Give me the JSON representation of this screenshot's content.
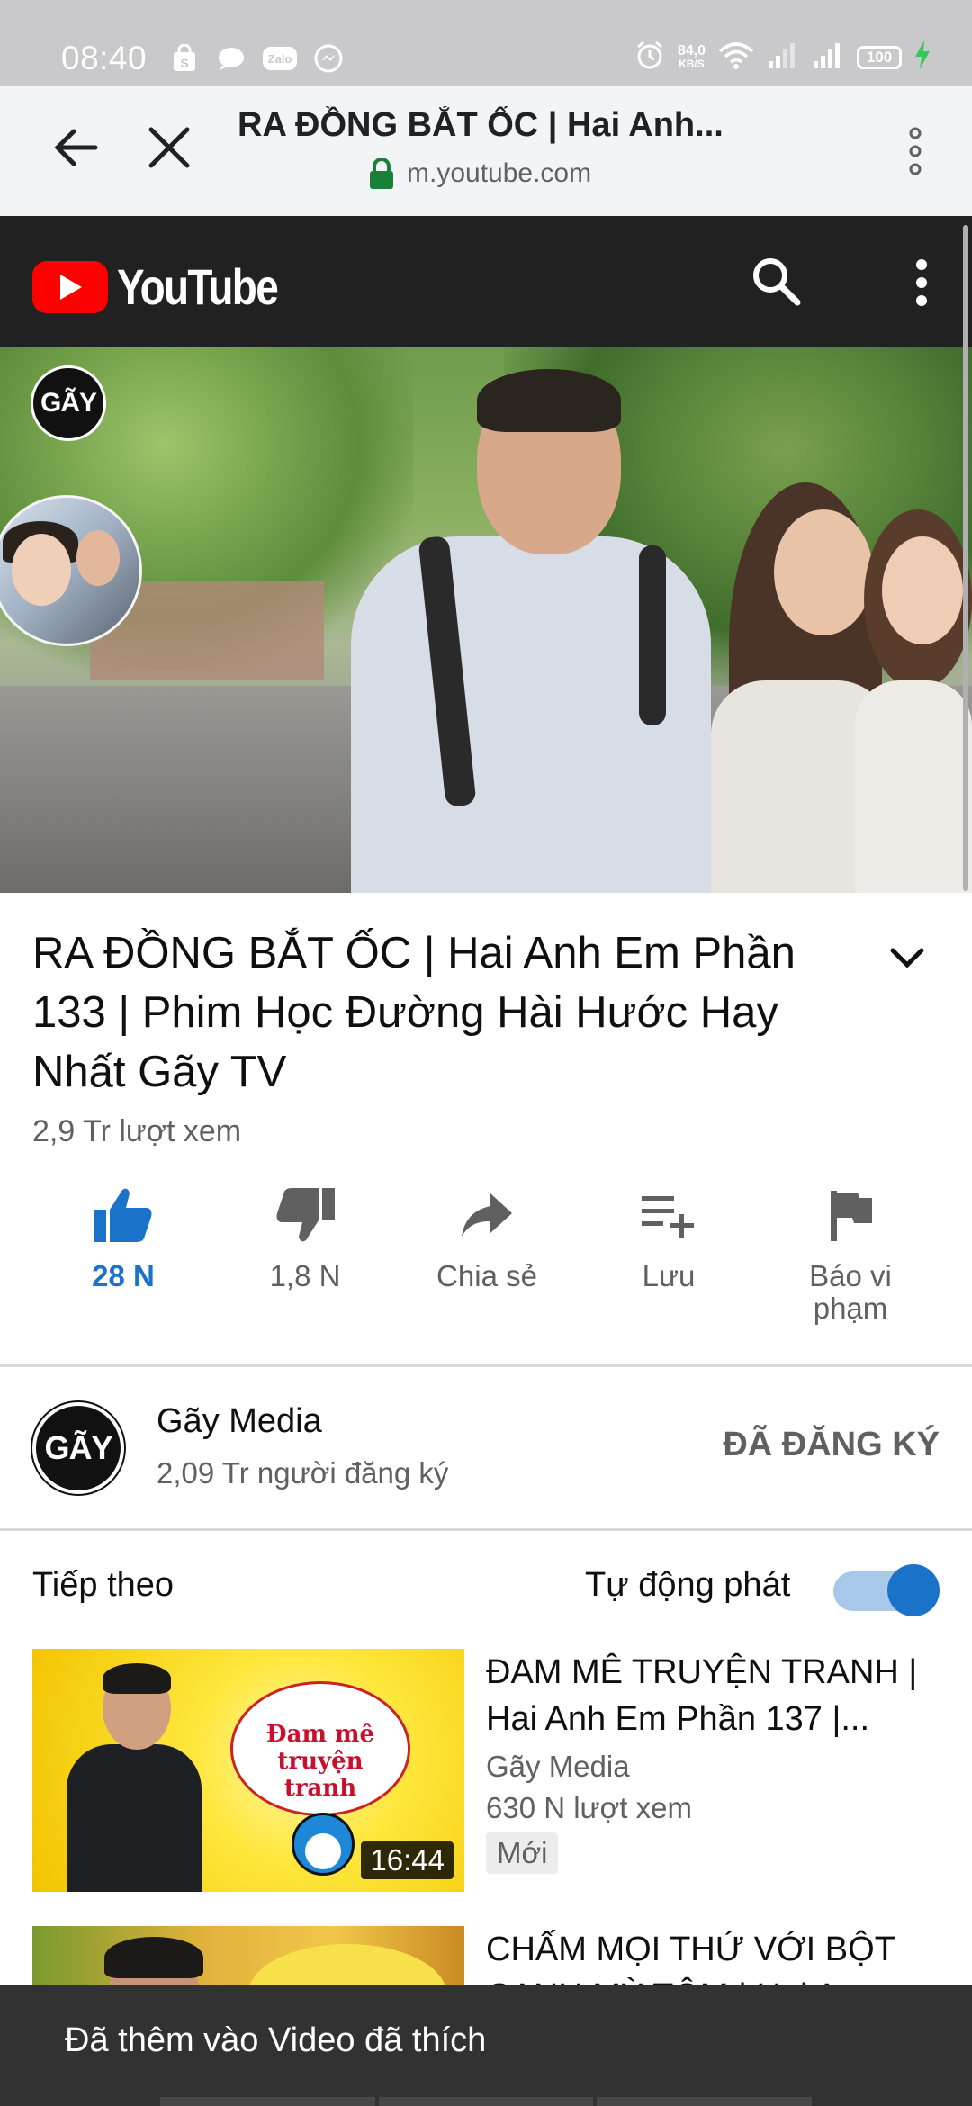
{
  "status_bar": {
    "time": "08:40",
    "left_icons": [
      "bag-icon",
      "chat-icon",
      "zalo-icon",
      "messenger-icon"
    ],
    "zalo_label": "Zalo",
    "speed_value": "84,0",
    "speed_unit": "KB/S",
    "battery": "100"
  },
  "browser": {
    "title": "RA ĐỒNG BẮT ỐC | Hai Anh...",
    "url": "m.youtube.com"
  },
  "youtube": {
    "wordmark": "YouTube"
  },
  "player": {
    "channel_badge": "GÃY"
  },
  "video": {
    "title": "RA ĐỒNG BẮT ỐC | Hai Anh Em Phần 133 | Phim Học Đường Hài Hước Hay Nhất Gãy TV",
    "views": "2,9 Tr lượt xem"
  },
  "actions": [
    {
      "label": "28 N",
      "icon": "thumb-up-icon",
      "active": true
    },
    {
      "label": "1,8 N",
      "icon": "thumb-down-icon",
      "active": false
    },
    {
      "label": "Chia sẻ",
      "icon": "share-icon",
      "active": false
    },
    {
      "label": "Lưu",
      "icon": "playlist-add-icon",
      "active": false
    },
    {
      "label": "Báo vi phạm",
      "icon": "flag-icon",
      "active": false
    }
  ],
  "channel": {
    "avatar_text": "GÃY",
    "name": "Gãy Media",
    "subscribers": "2,09 Tr người đăng ký",
    "subscribe_label": "ĐÃ ĐĂNG KÝ"
  },
  "up_next": {
    "label": "Tiếp theo",
    "autoplay_label": "Tự động phát",
    "autoplay_on": true
  },
  "recommendations": [
    {
      "title": "ĐAM MÊ TRUYỆN TRANH | Hai Anh Em Phần 137 |...",
      "channel": "Gãy Media",
      "views": "630 N lượt xem",
      "badge": "Mới",
      "duration": "16:44",
      "thumb_text": "Đam mê truyện tranh"
    },
    {
      "title": "CHẤM MỌI THỨ VỚI BỘT CANH MỲ TÔM | Hai A..."
    }
  ],
  "snackbar": {
    "text": "Đã thêm vào Video đã thích"
  },
  "colors": {
    "accent_blue": "#1a73c9",
    "youtube_red": "#ff0000",
    "header_dark": "#212121",
    "status_bar": "#c9c9cb",
    "snackbar": "#323232"
  }
}
